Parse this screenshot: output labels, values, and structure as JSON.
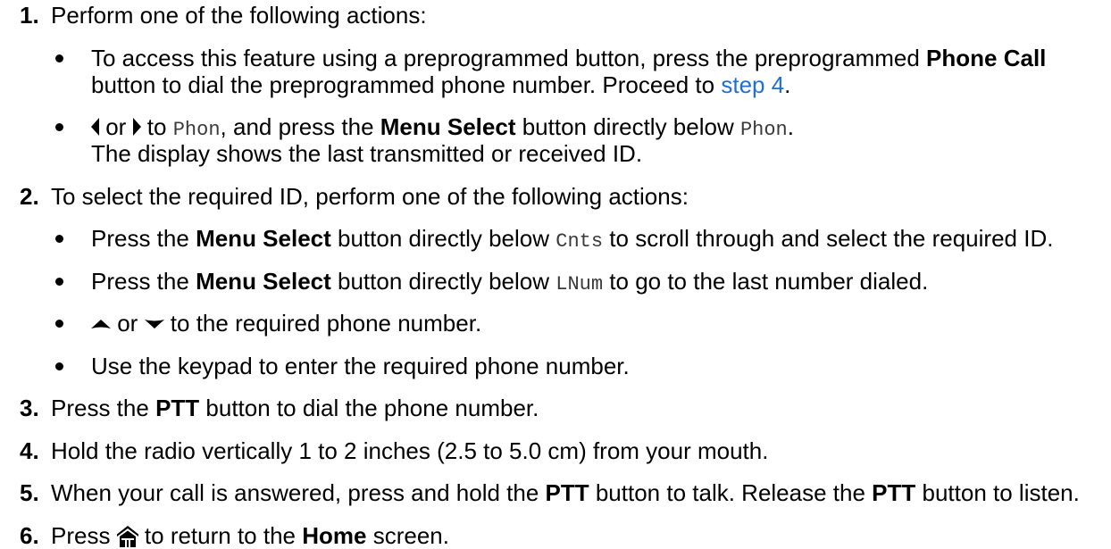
{
  "colors": {
    "text": "#000000",
    "link": "#1f6fd6",
    "code": "#3a3a3a"
  },
  "steps": [
    {
      "number": "1.",
      "text": "Perform one of the following actions:",
      "bullets": [
        {
          "line1": {
            "text": "To access this feature using a preprogrammed button, press the preprogrammed ",
            "bold": "Phone Call"
          },
          "line2": {
            "text": "button to dial the preprogrammed phone number. Proceed to ",
            "link": "step 4",
            "end": "."
          }
        },
        {
          "line1": {
            "icon_before": "left-navigation-icon",
            "or": " or ",
            "icon_after": "right-navigation-icon",
            "to": " to ",
            "code1": "Phon",
            "text1": ", and press the ",
            "bold": "Menu Select",
            "text2": " button directly below ",
            "code2": "Phon",
            "end": "."
          },
          "line2": {
            "text": "The display shows the last transmitted or received ID."
          }
        }
      ]
    },
    {
      "number": "2.",
      "text": "To select the required ID, perform one of the following actions:",
      "bullets": [
        {
          "text1": "Press the ",
          "bold": "Menu Select",
          "text2": " button directly below ",
          "code": "Cnts",
          "text3": " to scroll through and select the required ID."
        },
        {
          "text1": "Press the ",
          "bold": "Menu Select",
          "text2": " button directly below ",
          "code": "LNum",
          "text3": " to go to the last number dialed."
        },
        {
          "icon_before": "up-navigation-icon",
          "or": " or ",
          "icon_after": "down-navigation-icon",
          "text": " to the required phone number."
        },
        {
          "text": "Use the keypad to enter the required phone number."
        }
      ]
    },
    {
      "number": "3.",
      "text1": "Press the ",
      "bold": "PTT",
      "text2": " button to dial the phone number."
    },
    {
      "number": "4.",
      "text": "Hold the radio vertically 1 to 2 inches (2.5 to 5.0 cm) from your mouth."
    },
    {
      "number": "5.",
      "text1": "When your call is answered, press and hold the ",
      "bold1": "PTT",
      "text2": " button to talk. Release the ",
      "bold2": "PTT",
      "text3": " button to listen."
    },
    {
      "number": "6.",
      "text1": "Press ",
      "icon": "home-icon",
      "text2": " to return to the ",
      "bold": "Home",
      "text3": " screen."
    }
  ]
}
